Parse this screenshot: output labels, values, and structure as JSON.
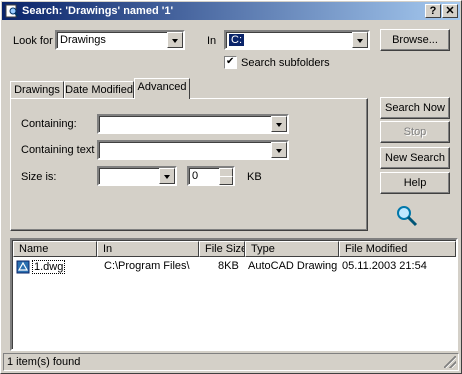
{
  "window": {
    "title": "Search: 'Drawings' named '1'",
    "help_btn": "?",
    "close_btn": "✕"
  },
  "search": {
    "look_for_label": "Look for",
    "look_for_value": "Drawings",
    "in_label": "In",
    "in_value": "C:",
    "browse_label": "Browse...",
    "search_subfolders_label": "Search subfolders",
    "search_subfolders_checked": "✔"
  },
  "tabs": [
    {
      "label": "Drawings"
    },
    {
      "label": "Date Modified"
    },
    {
      "label": "Advanced"
    }
  ],
  "advanced": {
    "containing_label": "Containing:",
    "containing_value": "",
    "containing_text_label": "Containing text",
    "containing_text_value": "",
    "size_label": "Size is:",
    "size_op_value": "",
    "size_value": "0",
    "size_unit": "KB"
  },
  "actions": {
    "search_now": "Search Now",
    "stop": "Stop",
    "new_search": "New Search",
    "help": "Help"
  },
  "results": {
    "columns": [
      "Name",
      "In",
      "File Size",
      "Type",
      "File Modified"
    ],
    "rows": [
      {
        "name": "1.dwg",
        "in": "C:\\Program Files\\",
        "size": "8KB",
        "type": "AutoCAD Drawing",
        "modified": "05.11.2003 21:54"
      }
    ]
  },
  "status": {
    "text": "1 item(s) found"
  }
}
